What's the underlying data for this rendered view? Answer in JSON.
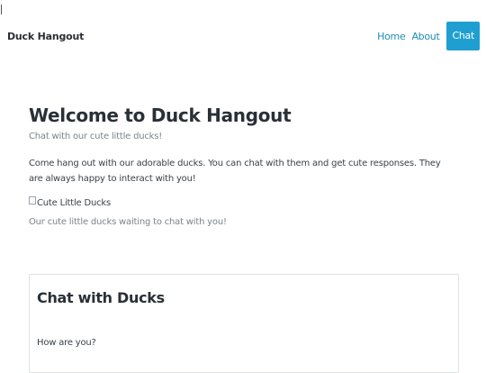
{
  "navbar": {
    "brand": "Duck Hangout",
    "links": [
      {
        "label": "Home"
      },
      {
        "label": "About"
      },
      {
        "label": "Chat"
      }
    ]
  },
  "main": {
    "title": "Welcome to Duck Hangout",
    "subtitle": "Chat with our cute little ducks!",
    "intro": "Come hang out with our adorable ducks. You can chat with them and get cute responses. They are always happy to interact with you!",
    "image_alt": "Cute Little Ducks",
    "caption": "Our cute little ducks waiting to chat with you!"
  },
  "chat": {
    "title": "Chat with Ducks",
    "messages": [
      {
        "text": "How are you?"
      }
    ]
  },
  "colors": {
    "accent": "#1f9fd1",
    "link": "#1f8cb6",
    "text": "#333a40",
    "muted": "#7a848c",
    "border": "#dfe3e6"
  }
}
